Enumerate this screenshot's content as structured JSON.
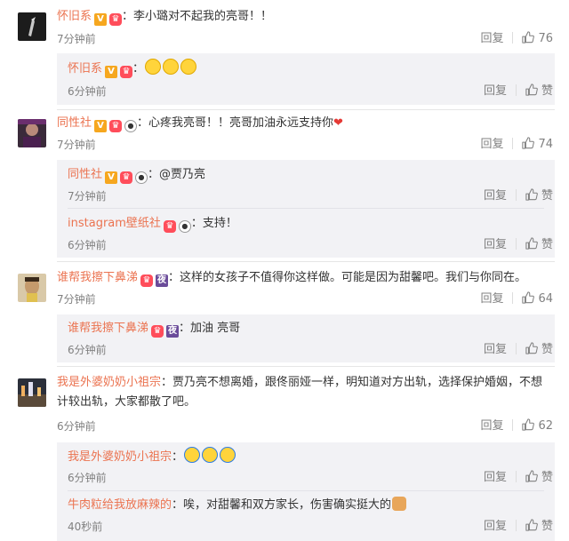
{
  "comments": [
    {
      "user": "怀旧系",
      "badges": [
        "V",
        "gift"
      ],
      "text": "：李小璐对不起我的亮哥！！",
      "time": "7分钟前",
      "reply_label": "回复",
      "likes": "76",
      "replies": [
        {
          "user": "怀旧系",
          "badges": [
            "V",
            "gift"
          ],
          "text": "：",
          "emojis": 3,
          "time": "6分钟前",
          "reply_label": "回复",
          "like_label": "赞"
        }
      ]
    },
    {
      "user": "同性社",
      "text": "：心疼我亮哥！！亮哥加油永远支持你",
      "time": "7分钟前",
      "reply_label": "回复",
      "likes": "74",
      "replies": [
        {
          "user": "同性社",
          "text": "：@贾乃亮",
          "time": "7分钟前",
          "reply_label": "回复",
          "like_label": "赞"
        },
        {
          "user": "instagram壁纸社",
          "text": "：支持！",
          "time": "6分钟前",
          "reply_label": "回复",
          "like_label": "赞"
        }
      ]
    },
    {
      "user": "谁帮我擦下鼻涕",
      "text": "：这样的女孩子不值得你这样做。可能是因为甜馨吧。我们与你同在。",
      "time": "7分钟前",
      "reply_label": "回复",
      "likes": "64",
      "replies": [
        {
          "user": "谁帮我擦下鼻涕",
          "text": "：加油 亮哥",
          "time": "6分钟前",
          "reply_label": "回复",
          "like_label": "赞"
        }
      ]
    },
    {
      "user": "我是外婆奶奶小祖宗",
      "text": "：贾乃亮不想离婚，跟佟丽娅一样，明知道对方出轨，选择保护婚姻，不想计较出轨，大家都散了吧。",
      "time": "6分钟前",
      "reply_label": "回复",
      "likes": "62",
      "replies": [
        {
          "user": "我是外婆奶奶小祖宗",
          "text": "：",
          "time": "6分钟前",
          "reply_label": "回复",
          "like_label": "赞"
        },
        {
          "user": "牛肉粒给我放麻辣的",
          "text": "：唉，对甜馨和双方家长，伤害确实挺大的",
          "time": "40秒前",
          "reply_label": "回复",
          "like_label": "赞"
        }
      ]
    }
  ]
}
